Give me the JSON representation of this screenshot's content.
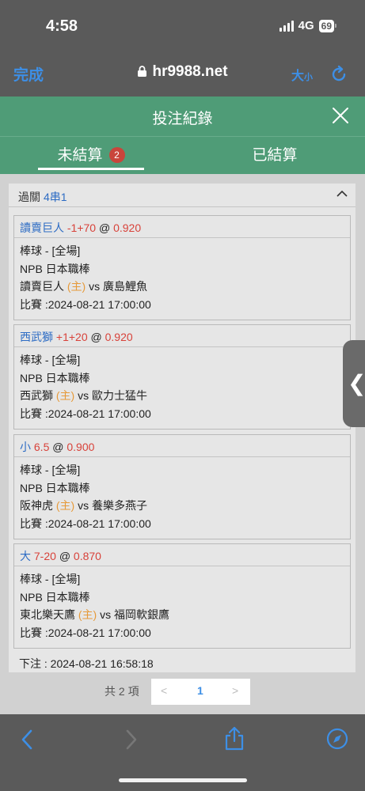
{
  "status": {
    "time": "4:58",
    "network": "4G",
    "battery": "69"
  },
  "browser": {
    "done_label": "完成",
    "url": "hr9988.net",
    "text_size_big": "大",
    "text_size_small": "小"
  },
  "modal": {
    "title": "投注紀錄"
  },
  "tabs": [
    {
      "label": "未結算",
      "badge": "2",
      "active": true
    },
    {
      "label": "已結算",
      "active": false
    }
  ],
  "slip": {
    "kind": "過關",
    "combo": "4串1",
    "bets": [
      {
        "pick": "讀賣巨人",
        "line": "-1+70",
        "at": "@",
        "odds": "0.920",
        "sport": "棒球 - [全場]",
        "league": "NPB 日本職棒",
        "home": "讀賣巨人",
        "home_tag": "(主)",
        "vs": "vs",
        "away": "廣島鯉魚",
        "match": "比賽 :2024-08-21 17:00:00"
      },
      {
        "pick": "西武獅",
        "line": "+1+20",
        "at": "@",
        "odds": "0.920",
        "sport": "棒球 - [全場]",
        "league": "NPB 日本職棒",
        "home": "西武獅",
        "home_tag": "(主)",
        "vs": "vs",
        "away": "歐力士猛牛",
        "match": "比賽 :2024-08-21 17:00:00"
      },
      {
        "pick": "小",
        "line": "6.5",
        "at": "@",
        "odds": "0.900",
        "sport": "棒球 - [全場]",
        "league": "NPB 日本職棒",
        "home": "阪神虎",
        "home_tag": "(主)",
        "vs": "vs",
        "away": "養樂多燕子",
        "match": "比賽 :2024-08-21 17:00:00"
      },
      {
        "pick": "大",
        "line": "7-20",
        "at": "@",
        "odds": "0.870",
        "sport": "棒球 - [全場]",
        "league": "NPB 日本職棒",
        "home": "東北樂天鷹",
        "home_tag": "(主)",
        "vs": "vs",
        "away": "福岡軟銀鷹",
        "match": "比賽 :2024-08-21 17:00:00"
      }
    ],
    "placed": "下注 : 2024-08-21 16:58:18"
  },
  "pager": {
    "total": "共 2 項",
    "prev": "<",
    "page": "1",
    "next": ">"
  },
  "side_handle": "❮",
  "colors": {
    "header_green": "#4f9c77",
    "link_blue": "#2d6cc4",
    "odds_red": "#d8423a",
    "home_orange": "#e69a3a",
    "safari_blue": "#3d8fe6"
  },
  "icons": [
    "lock-icon",
    "reload-icon",
    "close-icon",
    "chevron-up-icon",
    "back-icon",
    "forward-icon",
    "share-icon",
    "compass-icon"
  ]
}
